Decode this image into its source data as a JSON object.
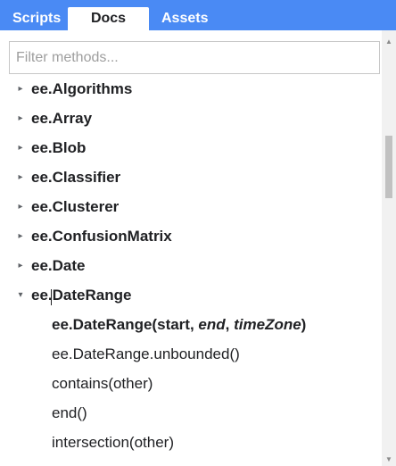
{
  "tabs": {
    "scripts": "Scripts",
    "docs": "Docs",
    "assets": "Assets",
    "active": "Docs",
    "bar_color": "#4a8af4"
  },
  "filter": {
    "placeholder": "Filter methods...",
    "value": ""
  },
  "tree": {
    "collapsed_arrow": "▸",
    "expanded_arrow": "▾",
    "items": [
      {
        "label": "ee.Algorithms",
        "expanded": false
      },
      {
        "label": "ee.Array",
        "expanded": false
      },
      {
        "label": "ee.Blob",
        "expanded": false
      },
      {
        "label": "ee.Classifier",
        "expanded": false
      },
      {
        "label": "ee.Clusterer",
        "expanded": false
      },
      {
        "label": "ee.ConfusionMatrix",
        "expanded": false
      },
      {
        "label": "ee.Date",
        "expanded": false
      },
      {
        "label": "ee.DateRange",
        "expanded": true
      }
    ],
    "daterange_methods": {
      "constructor": {
        "name": "ee.DateRange(",
        "arg1": "start",
        "sep1": ", ",
        "arg2": "end",
        "sep2": ", ",
        "arg3": "timeZone",
        "close": ")"
      },
      "others": [
        "ee.DateRange.unbounded()",
        "contains(other)",
        "end()",
        "intersection(other)"
      ]
    }
  },
  "scrollbar": {
    "up_arrow": "▲",
    "down_arrow": "▼"
  }
}
